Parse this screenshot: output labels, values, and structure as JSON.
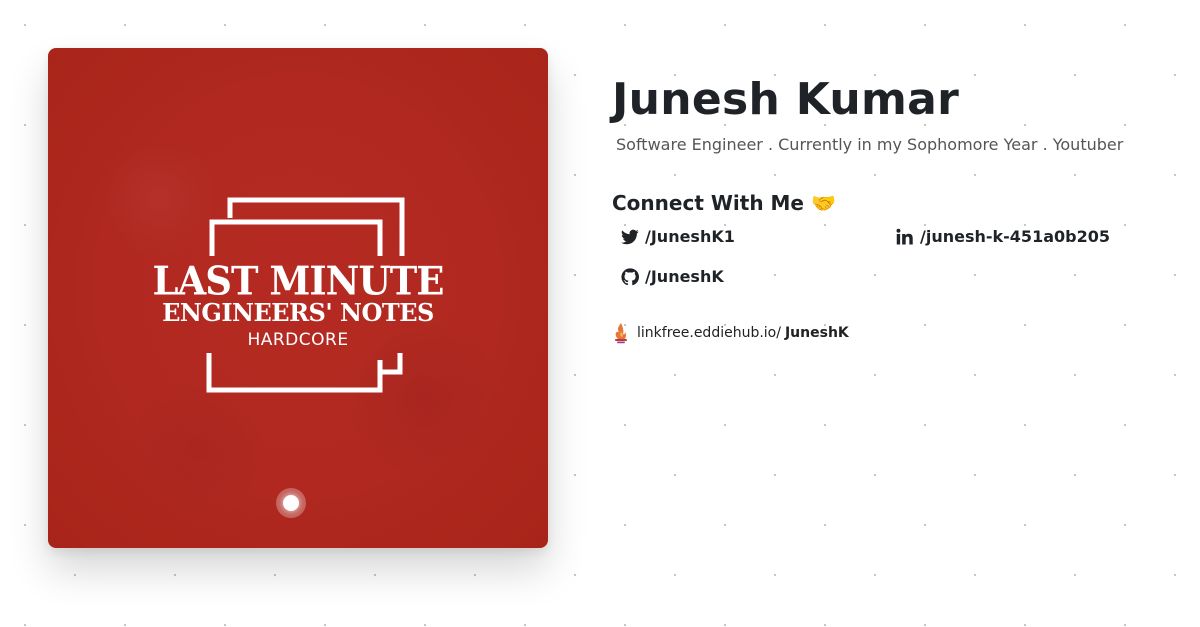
{
  "cover": {
    "title_line1": "LAST MINUTE",
    "title_line2": "ENGINEERS' NOTES",
    "subtitle": "HARDCORE",
    "background_color": "#b02820"
  },
  "profile": {
    "name": "Junesh Kumar",
    "bio": "Software Engineer . Currently in my Sophomore Year . Youtuber"
  },
  "connect": {
    "heading": "Connect With Me 🤝",
    "socials": [
      {
        "icon": "twitter-icon",
        "label": "/JuneshK1"
      },
      {
        "icon": "linkedin-icon",
        "label": "/junesh-k-451a0b205"
      },
      {
        "icon": "github-icon",
        "label": "/JuneshK"
      }
    ]
  },
  "linkfree": {
    "icon": "linkfree-logo-icon",
    "prefix": "linkfree.eddiehub.io/",
    "username": "JuneshK"
  }
}
